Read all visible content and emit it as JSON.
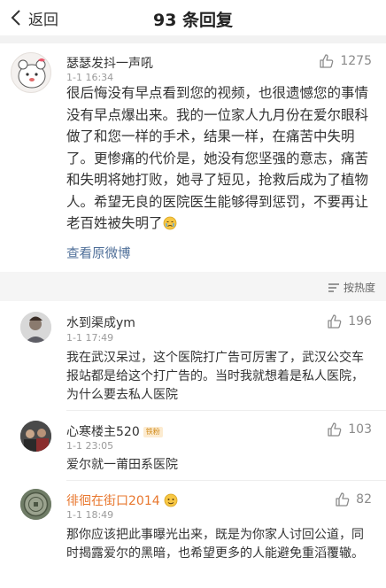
{
  "nav": {
    "back_label": "返回",
    "title": "93 条回复"
  },
  "main_comment": {
    "username": "瑟瑟发抖一声吼",
    "timestamp": "1-1 16:34",
    "likes": "1275",
    "body": "很后悔没有早点看到您的视频，也很遗憾您的事情没有早点爆出来。我的一位家人九月份在爱尔眼科做了和您一样的手术，结果一样，在痛苦中失明了。更惨痛的代价是，她没有您坚强的意志，痛苦和失明将她打败，她寻了短见，抢救后成为了植物人。希望无良的医院医生能够得到惩罚，不要再让老百姓被失明了",
    "view_original": "查看原微博"
  },
  "sort": {
    "label": "按热度"
  },
  "replies": [
    {
      "username": "水到渠成ym",
      "timestamp": "1-1 17:49",
      "likes": "196",
      "body": "我在武汉呆过，这个医院打广告可厉害了，武汉公交车报站都是给这个打广告的。当时我就想着是私人医院，为什么要去私人医院"
    },
    {
      "username": "心寒楼主520",
      "badge": "铁粉",
      "timestamp": "1-1 23:05",
      "likes": "103",
      "body": "爱尔就一莆田系医院"
    },
    {
      "username": "徘徊在街口2014",
      "timestamp": "1-1 18:49",
      "likes": "82",
      "body": "那你应该把此事曝光出来，既是为你家人讨回公道，同时揭露爱尔的黑暗，也希望更多的人能避免重滔覆辙。"
    }
  ],
  "colors": {
    "link": "#4f6f99",
    "orange_name": "#e8772e",
    "muted": "#9b9b9b"
  }
}
